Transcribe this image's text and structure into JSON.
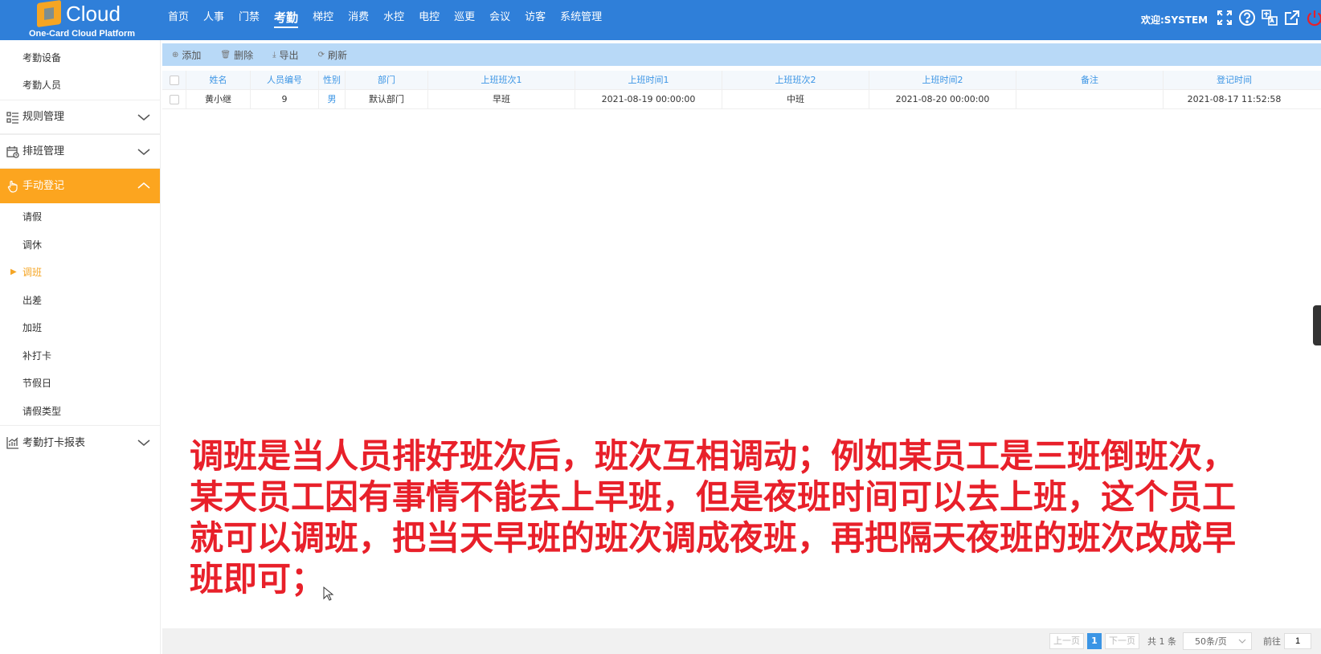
{
  "app": {
    "brand": "Cloud",
    "subtitle": "One-Card Cloud Platform",
    "welcome": "欢迎:SYSTEM"
  },
  "nav": [
    "首页",
    "人事",
    "门禁",
    "考勤",
    "梯控",
    "消费",
    "水控",
    "电控",
    "巡更",
    "会议",
    "访客",
    "系统管理"
  ],
  "nav_active": "考勤",
  "header_icons": [
    "fullscreen-icon",
    "help-icon",
    "language-icon",
    "edit-link-icon",
    "power-icon"
  ],
  "sidebar": {
    "top_items": [
      "考勤设备",
      "考勤人员"
    ],
    "groups": {
      "rules": "规则管理",
      "schedule": "排班管理",
      "manual": "手动登记",
      "report": "考勤打卡报表"
    },
    "manual_items": [
      "请假",
      "调休",
      "调班",
      "出差",
      "加班",
      "补打卡",
      "节假日",
      "请假类型"
    ],
    "active_item": "调班"
  },
  "toolbar": {
    "add": "添加",
    "delete": "删除",
    "export": "导出",
    "refresh": "刷新"
  },
  "table": {
    "columns": [
      "姓名",
      "人员编号",
      "性别",
      "部门",
      "上班班次1",
      "上班时间1",
      "上班班次2",
      "上班时间2",
      "备注",
      "登记时间"
    ],
    "rows": [
      [
        "黄小继",
        "9",
        "男",
        "默认部门",
        "早班",
        "2021-08-19 00:00:00",
        "中班",
        "2021-08-20 00:00:00",
        "",
        "2021-08-17 11:52:58"
      ]
    ]
  },
  "caption": [
    "调班是当人员排好班次后，班次互相调动；例如某员工是三班倒班次，",
    "某天员工因有事情不能去上早班，但是夜班时间可以去上班，这个员工",
    "就可以调班，把当天早班的班次调成夜班，再把隔天夜班的班次改成早",
    "班即可；"
  ],
  "pagination": {
    "prev": "上一页",
    "current": "1",
    "next": "下一页",
    "total": "共 1 条",
    "page_size": "50条/页",
    "goto": "前往",
    "goto_value": "1"
  },
  "colors": {
    "topbar": "#2f7fd9",
    "accent": "#fca51f",
    "caption": "#e8202a",
    "link": "#3b95e5"
  }
}
